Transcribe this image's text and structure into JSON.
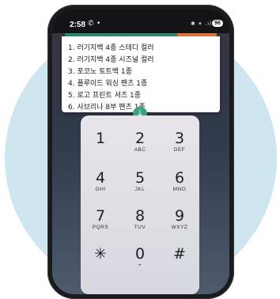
{
  "status_bar": {
    "time": "2:58",
    "call_icon": "phone-call-icon",
    "dot": "•",
    "indicators": "✱ ▾ .ıl",
    "battery": "96"
  },
  "colors": {
    "accent_green": "#2e8b6f",
    "accent_orange": "#e07a3b",
    "collapse_button": "#3ba17f",
    "background_circle": "#cfe5ef"
  },
  "list": {
    "items": [
      "1. 러기지백 4종 스테디 컬러",
      "2. 러기지백 4종 시즈널 컬러",
      "3. 포코노 토트백 1종",
      "4. 플루이드 워싱 팬츠 1종",
      "5. 로고 프린트 셔츠 1종",
      "6. 사브리나 8부 팬츠 1종"
    ]
  },
  "collapse_button": {
    "icon": "arrow-down-icon",
    "glyph": "↓"
  },
  "keypad": {
    "keys": [
      {
        "digit": "1",
        "letters": ""
      },
      {
        "digit": "2",
        "letters": "ABC"
      },
      {
        "digit": "3",
        "letters": "DEF"
      },
      {
        "digit": "4",
        "letters": "GHI"
      },
      {
        "digit": "5",
        "letters": "JKL"
      },
      {
        "digit": "6",
        "letters": "MNO"
      },
      {
        "digit": "7",
        "letters": "PQRS"
      },
      {
        "digit": "8",
        "letters": "TUV"
      },
      {
        "digit": "9",
        "letters": "WXYZ"
      },
      {
        "digit": "✳",
        "letters": ""
      },
      {
        "digit": "0",
        "letters": "+"
      },
      {
        "digit": "#",
        "letters": ""
      }
    ]
  }
}
